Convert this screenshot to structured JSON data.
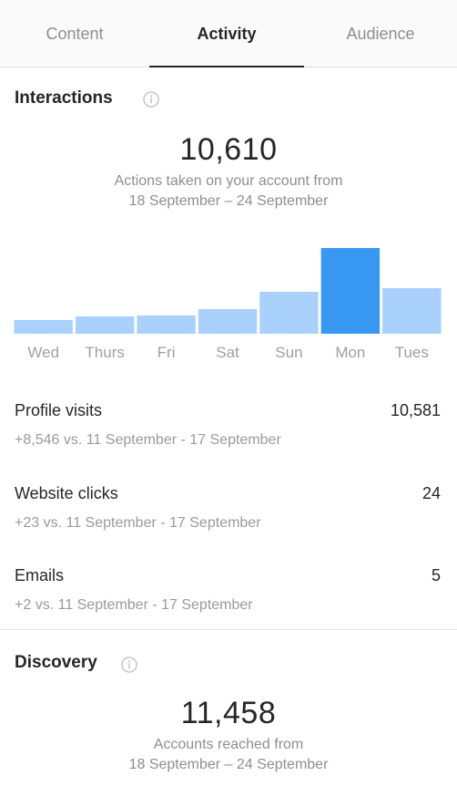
{
  "tabs": [
    {
      "label": "Content",
      "active": false
    },
    {
      "label": "Activity",
      "active": true
    },
    {
      "label": "Audience",
      "active": false
    }
  ],
  "interactions": {
    "title": "Interactions",
    "info_icon": "info-circle-icon",
    "total": "10,610",
    "subtitle_line1": "Actions taken on your account from",
    "subtitle_line2": "18 September – 24 September"
  },
  "chart_data": {
    "type": "bar",
    "categories": [
      "Wed",
      "Thurs",
      "Fri",
      "Sat",
      "Sun",
      "Mon",
      "Tues"
    ],
    "values": [
      15,
      19,
      20,
      27,
      46,
      94,
      50
    ],
    "highlight_index": 5,
    "colors": {
      "normal": "#a9d1fb",
      "highlight": "#3897f0"
    },
    "ylim": [
      0,
      100
    ],
    "grid": false,
    "title": "",
    "xlabel": "",
    "ylabel": ""
  },
  "metrics": [
    {
      "label": "Profile visits",
      "value": "10,581",
      "compare": "+8,546 vs. 11 September - 17 September"
    },
    {
      "label": "Website clicks",
      "value": "24",
      "compare": "+23 vs. 11 September - 17 September"
    },
    {
      "label": "Emails",
      "value": "5",
      "compare": "+2 vs. 11 September - 17 September"
    }
  ],
  "discovery": {
    "title": "Discovery",
    "info_icon": "info-circle-icon",
    "total": "11,458",
    "subtitle_line1": "Accounts reached from",
    "subtitle_line2": "18 September – 24 September"
  }
}
